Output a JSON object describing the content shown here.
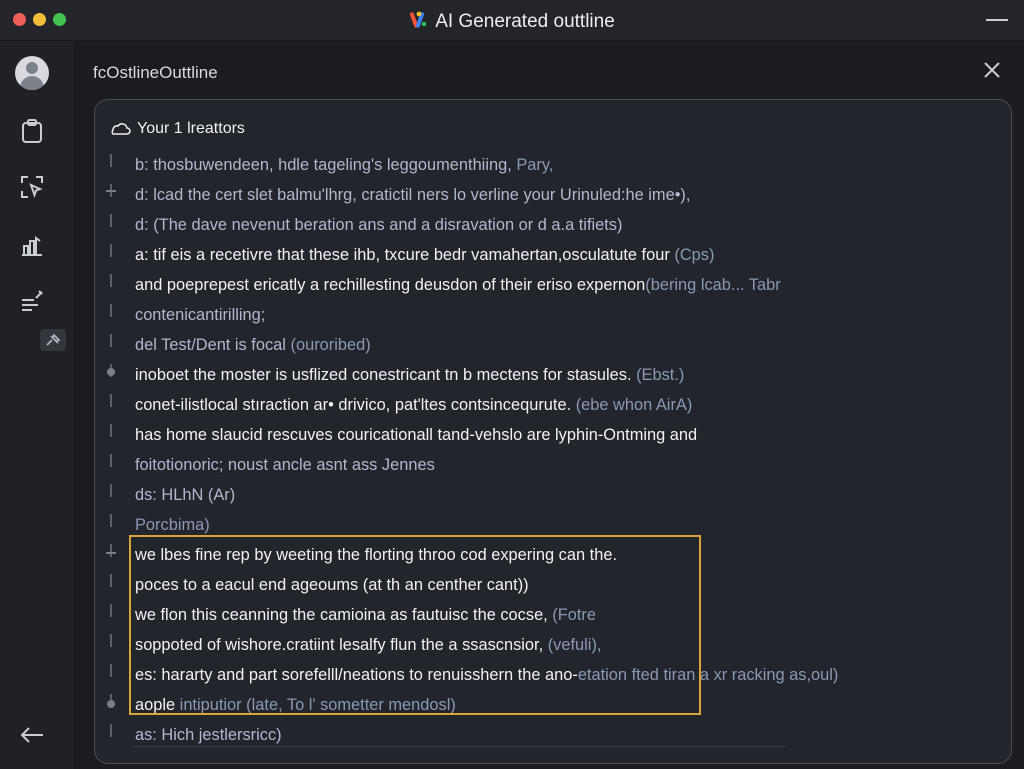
{
  "app": {
    "title": "AI Generated outtline",
    "logo_icon": "ai-sparkle-logo-icon",
    "colors": {
      "accent": "#d9a43b",
      "muted_text": "#8d97b4",
      "background": "#1a1c21"
    }
  },
  "panel": {
    "title": "fcOstlineOuttline",
    "card_title": "Your 1 lreattors"
  },
  "sidebar": {
    "icons": [
      "avatar",
      "clipboard-icon",
      "cursor-select-icon",
      "chart-icon",
      "list-edit-icon",
      "pin-icon"
    ],
    "back_icon": "back-arrow-icon"
  },
  "lines": [
    {
      "t": "b: thosbuwendeen, hdle tageling's leggoumenthiing, ",
      "m": "Pary,",
      "dim": true
    },
    {
      "t": "d: lcad the cert slet balmu'lhrg, cratictil ners lo verline your Urinuled:he ime•),",
      "m": "",
      "dim": true
    },
    {
      "t": "d: (The dave nevenut beration ans and a disravation or d a.a tifiets)",
      "m": "",
      "dim": true
    },
    {
      "t": "a: tif eis a recetivre that these ihb, txcure bedr vamahertan,osculatute four ",
      "m": "(Cps)",
      "dim": false
    },
    {
      "t": "and poeprepest ericatly a rechillesting deusdon of their eriso expernon",
      "m": "(bering lcab... Tabr",
      "dim": false
    },
    {
      "t": "contenicantirilling;",
      "m": "",
      "dim": true
    },
    {
      "t": "del Test/Dent is focal ",
      "m": "(ouroribed)",
      "dim": true
    },
    {
      "t": "inoboet the moster is usflized conestricant tn b mectens for stasules. ",
      "m": "(Ebst.)",
      "dim": false
    },
    {
      "t": "conet-ilistlocal stıraction ar• drivico, pat'ltes contsincequrute. ",
      "m": "(ebe whon AirA)",
      "dim": false
    },
    {
      "t": "has home slaucid rescuves couricationall tand-vehslo are lyphin-Ontming and",
      "m": "",
      "dim": false
    },
    {
      "t": "foitotionoric; noust ancle asnt ass Jennes",
      "m": "",
      "dim": true
    },
    {
      "t": "ds: HLhN (Ar)",
      "m": "",
      "dim": true
    },
    {
      "t": "",
      "m": "Porcbima)",
      "dim": true
    },
    {
      "t": "we lbes fine rep by weeting the florting throo cod expering can the.",
      "m": "",
      "dim": false
    },
    {
      "t": "poces to a eacul end ageoums (at th an centher cant))",
      "m": "",
      "dim": false
    },
    {
      "t": "we flon this ceanning the camioina as fautuisc the cocse, ",
      "m": "(Fotre",
      "dim": false
    },
    {
      "t": "soppoted of wishore.cratiint lesalfy flun the a ssascnsior, ",
      "m": "(vefuli),",
      "dim": false
    },
    {
      "t": "es: hararty and part sorefelll/neations to renuisshern the ano-",
      "m": "etation fted tiran a xr racking as,oul)",
      "dim": false
    },
    {
      "t": "aople ",
      "m": "intiputior (late, To l' sometter mendosl)",
      "dim": false
    },
    {
      "t": "as: Hich jestlersricc)",
      "m": "",
      "dim": true
    }
  ]
}
